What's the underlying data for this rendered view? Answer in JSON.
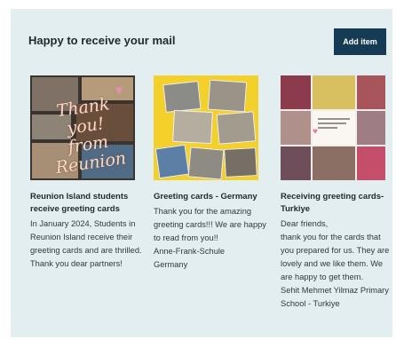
{
  "header": {
    "title": "Happy to receive your mail",
    "add_button_label": "Add item"
  },
  "cards": [
    {
      "title": "Reunion Island students receive greeting cards",
      "description": "In January 2024, Students in Reunion Island receive their greeting cards and are thrilled. Thank you dear partners!",
      "image_text": "Thank you! from Reunion"
    },
    {
      "title": "Greeting cards - Germany",
      "description": "Thank you for the amazing greeting cards!!! We are happy to read from you!!\nAnne-Frank-Schule\nGermany"
    },
    {
      "title": "Receiving greeting cards-Turkiye",
      "description": "Dear friends,\nthank you for the cards that you prepared for us. They are lovely and we like them. We are happy to get them.\nSehit Mehmet Yilmaz Primary School - Turkiye"
    }
  ],
  "colors": {
    "panel_background": "#e3eef0",
    "button_background": "#163c55",
    "thumb_germany_background": "#f4d02a"
  }
}
